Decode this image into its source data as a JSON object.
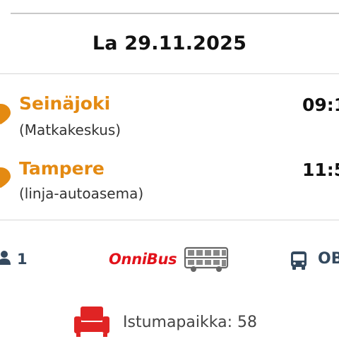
{
  "trip": {
    "date": "La 29.11.2025",
    "departure": {
      "city": "Seinäjoki",
      "place": "(Matkakeskus)",
      "time": "09:1"
    },
    "arrival": {
      "city": "Tampere",
      "place": "(linja-autoasema)",
      "time": "11:5"
    }
  },
  "details": {
    "passengers": "1",
    "operator_logo_text": "OnniBus",
    "line_code": "OB"
  },
  "seat": {
    "label": "Istumapaikka: 58"
  },
  "colors": {
    "accent": "#e48a12",
    "brand": "#e2121b",
    "seat": "#e02424",
    "icon": "#34495e"
  },
  "icons": [
    "location-pin-icon",
    "passenger-icon",
    "double-decker-bus-icon",
    "bus-icon",
    "seat-icon"
  ]
}
